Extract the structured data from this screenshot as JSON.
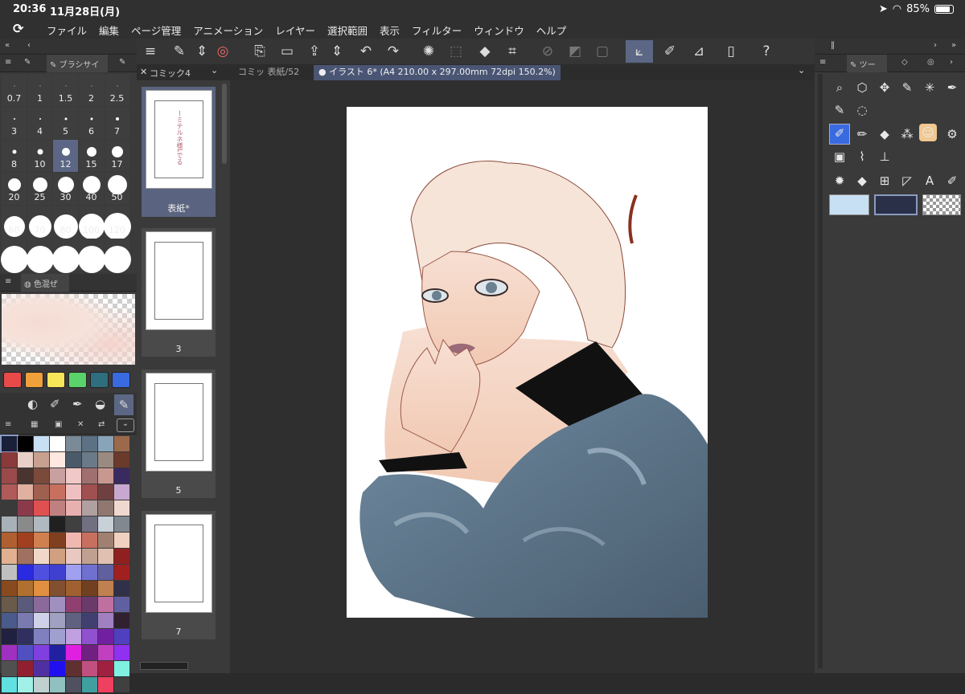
{
  "status": {
    "time": "20:36",
    "date": "11月28日(月)",
    "battery": "85%"
  },
  "menu": [
    "ファイル",
    "編集",
    "ページ管理",
    "アニメーション",
    "レイヤー",
    "選択範囲",
    "表示",
    "フィルター",
    "ウィンドウ",
    "ヘルプ"
  ],
  "brush_panel": {
    "tab_label": "ブラシサイ",
    "sizes": [
      "0.7",
      "1",
      "1.5",
      "2",
      "2.5",
      "3",
      "4",
      "5",
      "6",
      "7",
      "8",
      "10",
      "12",
      "15",
      "17",
      "20",
      "25",
      "30",
      "40",
      "50",
      "60",
      "70",
      "80",
      "100",
      "120",
      "",
      "",
      "",
      "",
      ""
    ],
    "selected": "12"
  },
  "color_mix_panel": {
    "tab_label": "色混ぜ"
  },
  "quick_colors": [
    "#e84a4a",
    "#f0a03a",
    "#f5e65a",
    "#5ad36a",
    "#2e6e7e",
    "#3a6ae0"
  ],
  "palette": [
    "#1a1f3a",
    "#000000",
    "#c8e0f4",
    "#ffffff",
    "#7a8a96",
    "#5c7184",
    "#88a4b8",
    "#9c6a4a",
    "#8a3a3a",
    "#e8d0c8",
    "#c8a090",
    "#ffe8e0",
    "#4a5a68",
    "#6a7a88",
    "#9a8a80",
    "#6a3a2a",
    "#9a4a4a",
    "#4a3430",
    "#7a4a3a",
    "#c8a0a0",
    "#f0c8c8",
    "#a07070",
    "#c89890",
    "#3a2a60",
    "#b05a5a",
    "#e0b0a0",
    "#a06050",
    "#c87060",
    "#f0c0c0",
    "#a05050",
    "#704040",
    "#c8a8d0",
    "#3a3a3a",
    "#8a3a4a",
    "#e05050",
    "#c08080",
    "#e8b0b0",
    "#b0a0a0",
    "#907870",
    "#f0d8d0",
    "#a8b0b8",
    "#8a8a8a",
    "#b0b8c0",
    "#202020",
    "#404040",
    "#707080",
    "#c8d0d8",
    "#808890",
    "#b06030",
    "#a04020",
    "#d08050",
    "#804020",
    "#f0b8b0",
    "#c87060",
    "#a08070",
    "#f0d0c0",
    "#e0b090",
    "#a07060",
    "#f0d8c8",
    "#d0a080",
    "#e8c8c0",
    "#c0a090",
    "#e0c0b0",
    "#902020",
    "#c0c0c0",
    "#2a2ae0",
    "#5050e0",
    "#4040d0",
    "#a0a0f0",
    "#7070d0",
    "#6060a0",
    "#a02020",
    "#8a4a20",
    "#b07030",
    "#e09040",
    "#805030",
    "#a06030",
    "#704020",
    "#c08050",
    "#303048",
    "#6a5a4a",
    "#5a5a7a",
    "#8a6a9a",
    "#a090c0",
    "#904070",
    "#6a3a6a",
    "#c070a0",
    "#6060a0",
    "#4a5a8a",
    "#7a7ab0",
    "#d0d0e8",
    "#a0a0c0",
    "#606080",
    "#404070",
    "#a080c0",
    "#302030",
    "#202040",
    "#303060",
    "#8080c0",
    "#a0a0d0",
    "#c0a0e0",
    "#9050d0",
    "#7020a0",
    "#5040c0",
    "#a030c0",
    "#5050c0",
    "#8040e0",
    "#2020a0",
    "#e020e0",
    "#702080",
    "#c040c0",
    "#9030f0",
    "#505050",
    "#902030",
    "#5030a0",
    "#2010f0",
    "#603030",
    "#c05080",
    "#a02040",
    "#80f0e0",
    "#60e0e0",
    "#a0f0e8",
    "#c0d0d0",
    "#90c0c0",
    "#505060",
    "#40a0a0",
    "#f04060",
    "#404040"
  ],
  "pages": [
    {
      "label": "表紙*",
      "selected": true
    },
    {
      "label": "3",
      "selected": false
    },
    {
      "label": "5",
      "selected": false
    },
    {
      "label": "7",
      "selected": false
    }
  ],
  "page_tab_label": "コミック4",
  "document_tabs": [
    {
      "label": "コミッ 表紙/52",
      "active": false
    },
    {
      "label": "● イラスト 6* (A4 210.00 x 297.00mm 72dpi 150.2%)",
      "active": true
    }
  ],
  "tool_panel": {
    "tab_label": "ツー",
    "sub_tool_colors": [
      "#c8e0f4",
      "#2a3048"
    ]
  }
}
